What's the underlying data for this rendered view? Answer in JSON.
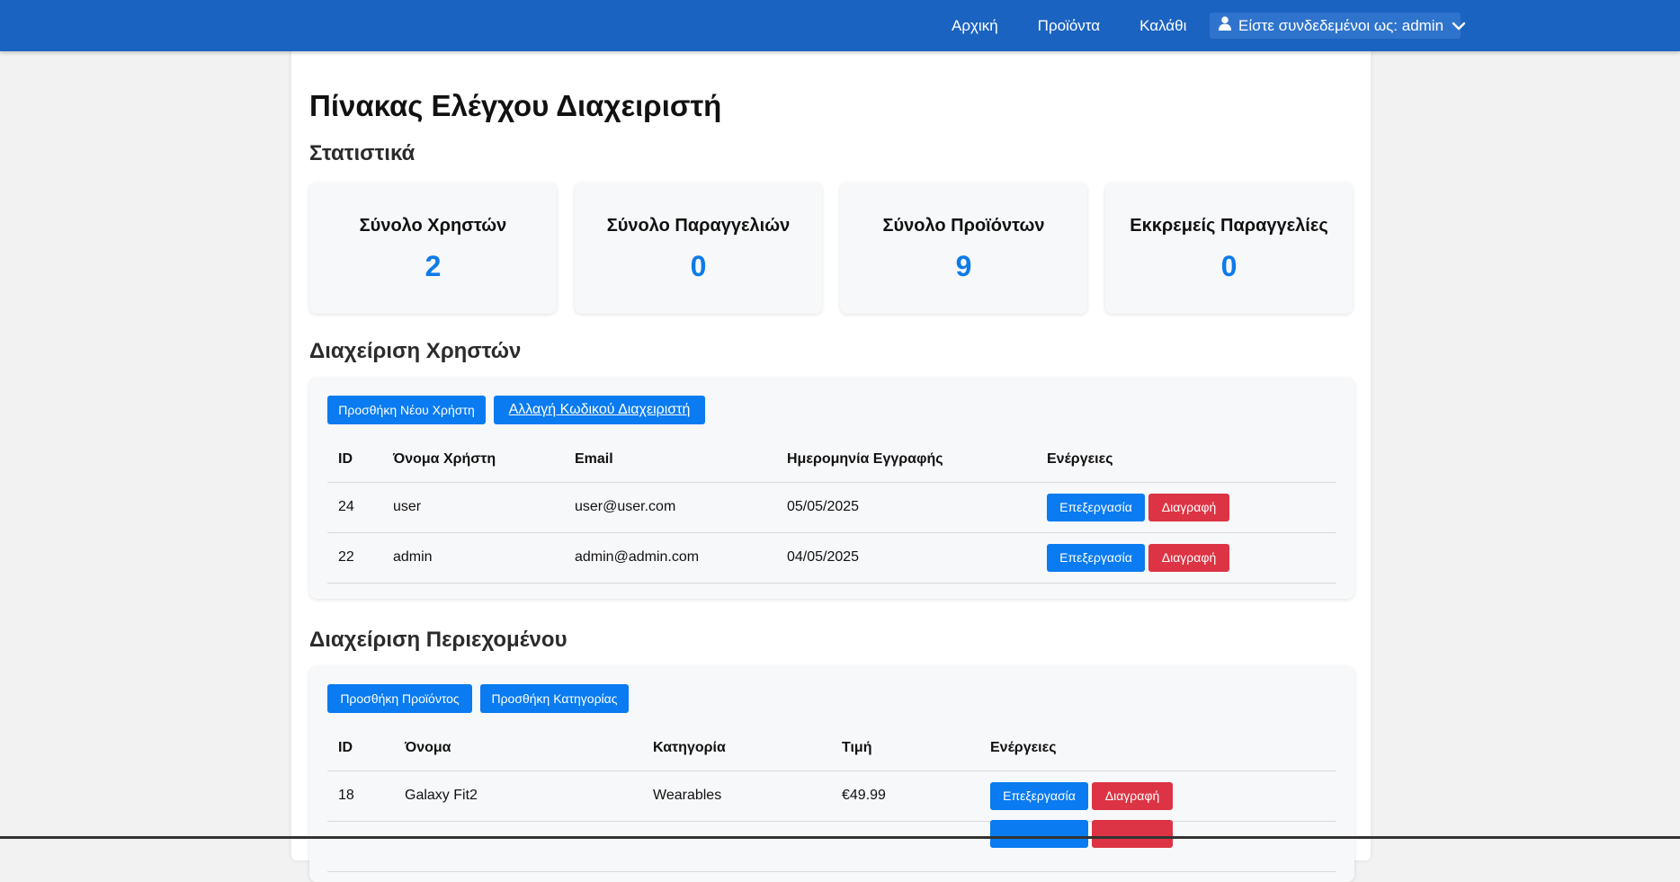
{
  "nav": {
    "home": "Αρχική",
    "products": "Προϊόντα",
    "cart": "Καλάθι",
    "user_label": "Είστε συνδεδεμένοι ως: admin"
  },
  "page": {
    "title": "Πίνακας Ελέγχου Διαχειριστή"
  },
  "stats": {
    "heading": "Στατιστικά",
    "cards": [
      {
        "label": "Σύνολο Χρηστών",
        "value": "2"
      },
      {
        "label": "Σύνολο Παραγγελιών",
        "value": "0"
      },
      {
        "label": "Σύνολο Προϊόντων",
        "value": "9"
      },
      {
        "label": "Εκκρεμείς Παραγγελίες",
        "value": "0"
      }
    ]
  },
  "users": {
    "heading": "Διαχείριση Χρηστών",
    "add_button": "Προσθήκη Νέου Χρήστη",
    "change_password_button": "Αλλαγή Κωδικού Διαχειριστή",
    "columns": [
      "ID",
      "Όνομα Χρήστη",
      "Email",
      "Ημερομηνία Εγγραφής",
      "Ενέργειες"
    ],
    "rows": [
      {
        "id": "24",
        "username": "user",
        "email": "user@user.com",
        "date": "05/05/2025"
      },
      {
        "id": "22",
        "username": "admin",
        "email": "admin@admin.com",
        "date": "04/05/2025"
      }
    ],
    "edit_label": "Επεξεργασία",
    "delete_label": "Διαγραφή"
  },
  "content": {
    "heading": "Διαχείριση Περιεχομένου",
    "add_product_button": "Προσθήκη Προϊόντος",
    "add_category_button": "Προσθήκη Κατηγορίας",
    "columns": [
      "ID",
      "Όνομα",
      "Κατηγορία",
      "Τιμή",
      "Ενέργειες"
    ],
    "rows": [
      {
        "id": "18",
        "name": "Galaxy Fit2",
        "category": "Wearables",
        "price": "€49.99"
      }
    ],
    "edit_label": "Επεξεργασία",
    "delete_label": "Διαγραφή"
  },
  "colors": {
    "navbar": "#1b63c0",
    "accent_blue": "#0a7bf0",
    "danger_red": "#dc3444",
    "stat_value": "#0d7bea"
  },
  "icons": {
    "user": "user-icon",
    "dropdown": "chevron-down-icon"
  }
}
